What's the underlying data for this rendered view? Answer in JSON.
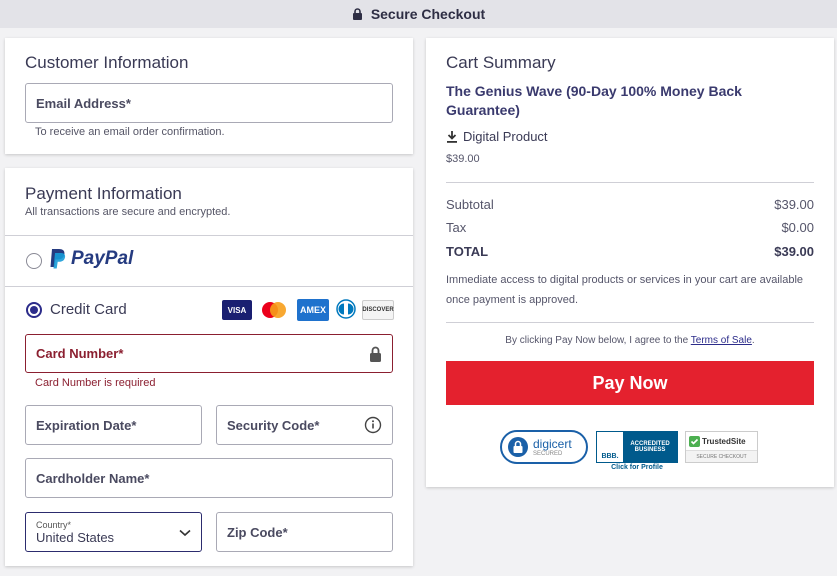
{
  "topbar": {
    "label": "Secure Checkout"
  },
  "customer": {
    "heading": "Customer Information",
    "email_label": "Email Address*",
    "email_help": "To receive an email order confirmation."
  },
  "payment": {
    "heading": "Payment Information",
    "subtext": "All transactions are secure and encrypted.",
    "paypal_label": "PayPal",
    "credit_card_label": "Credit Card",
    "card_logos": [
      "VISA",
      "mastercard",
      "AMEX",
      "diners",
      "DISCOVER"
    ],
    "card_number_label": "Card Number*",
    "card_number_error": "Card Number is required",
    "expiration_label": "Expiration Date*",
    "security_label": "Security Code*",
    "cardholder_label": "Cardholder Name*",
    "country_label": "Country*",
    "country_value": "United States",
    "zip_label": "Zip Code*"
  },
  "cart": {
    "heading": "Cart Summary",
    "product_name": "The Genius Wave (90-Day 100% Money Back Guarantee)",
    "product_type": "Digital Product",
    "product_price": "$39.00",
    "subtotal_label": "Subtotal",
    "subtotal_value": "$39.00",
    "tax_label": "Tax",
    "tax_value": "$0.00",
    "total_label": "TOTAL",
    "total_value": "$39.00",
    "access_note": "Immediate access to digital products or services in your cart are available once payment is approved.",
    "terms_prefix": "By clicking Pay Now below, I agree to the ",
    "terms_link": "Terms of Sale",
    "terms_suffix": ".",
    "pay_button": "Pay Now"
  },
  "badges": {
    "digicert": "digicert",
    "digicert_sub": "SECURED",
    "bbb_line1": "ACCREDITED",
    "bbb_line2": "BUSINESS",
    "bbb_mark": "BBB.",
    "bbb_caption": "Click for Profile",
    "trusted": "TrustedSite",
    "trusted_sub": "SECURE CHECKOUT"
  },
  "colors": {
    "accent": "#2c2c8a",
    "pay_button": "#e4212e",
    "error": "#8b1f30"
  }
}
